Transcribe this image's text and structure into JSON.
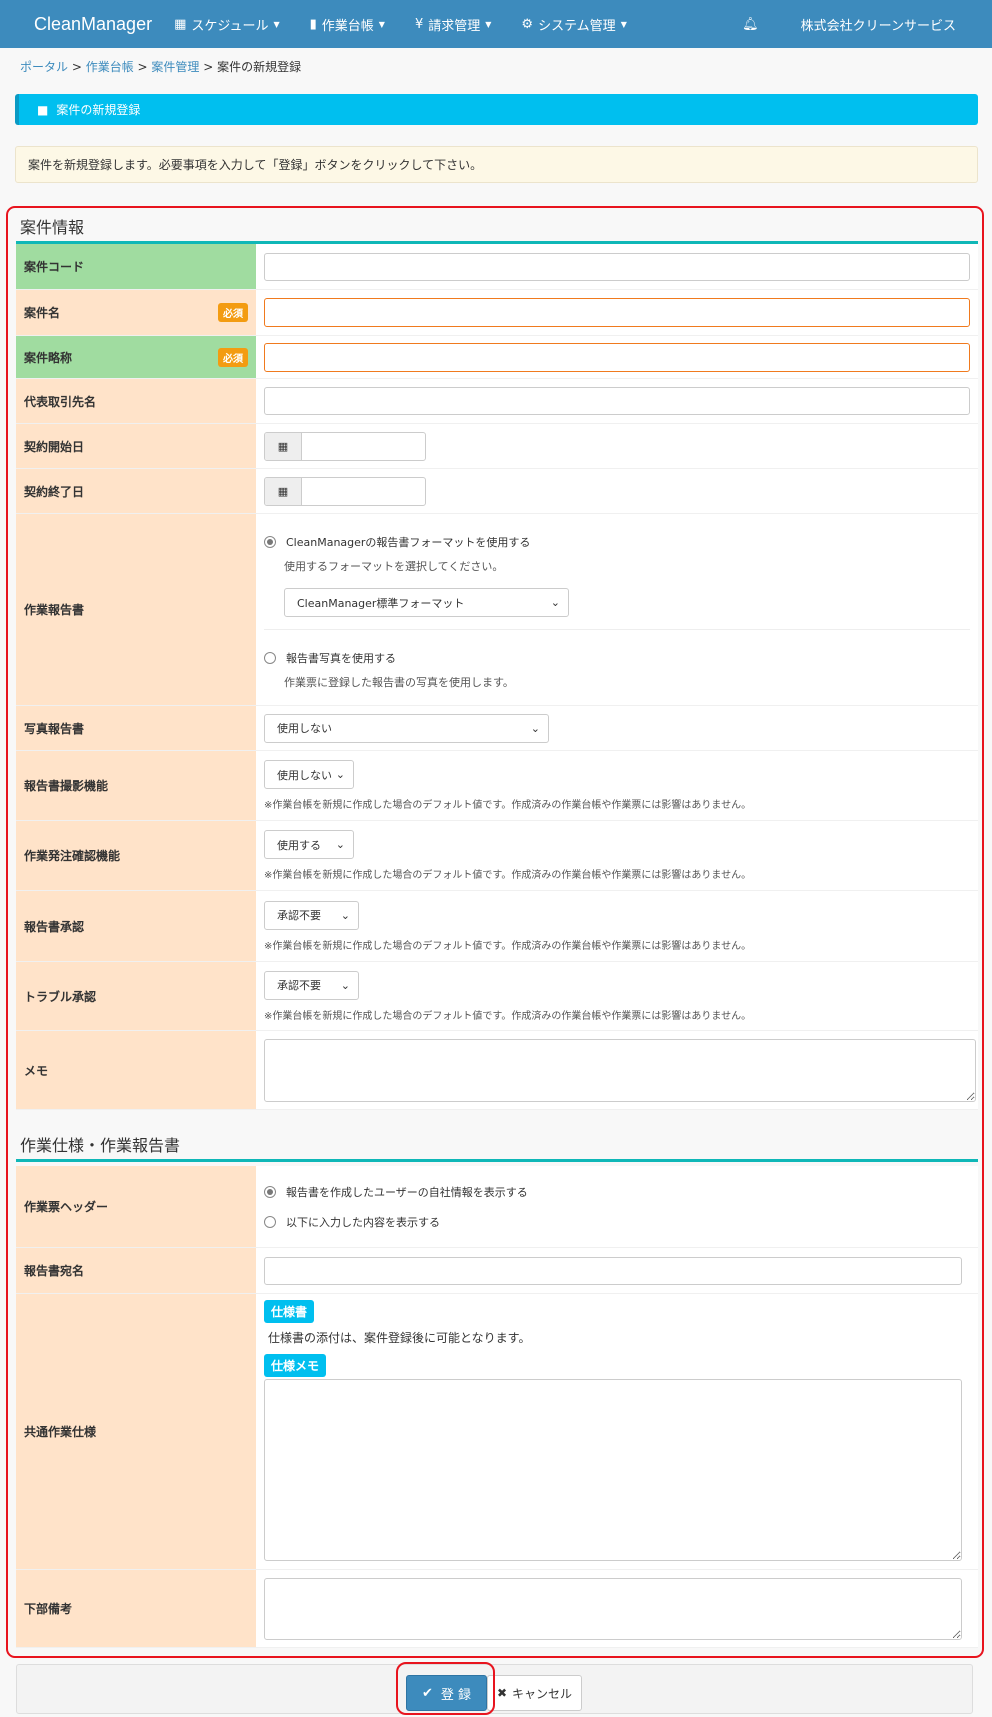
{
  "nav": {
    "brand": "CleanManager",
    "items": [
      {
        "icon": "calendar-icon",
        "label": "スケジュール"
      },
      {
        "icon": "book-icon",
        "label": "作業台帳"
      },
      {
        "icon": "yen-icon",
        "label": "請求管理"
      },
      {
        "icon": "gears-icon",
        "label": "システム管理"
      }
    ],
    "bell": "bell-icon",
    "company": "株式会社クリーンサービス"
  },
  "breadcrumb": [
    "ポータル",
    "作業台帳",
    "案件管理",
    "案件の新規登録"
  ],
  "title": "案件の新規登録",
  "alert": "案件を新規登録します。必要事項を入力して「登録」ボタンをクリックして下さい。",
  "required_label": "必須",
  "section1": {
    "heading": "案件情報",
    "fields": {
      "code": "案件コード",
      "name": "案件名",
      "short": "案件略称",
      "client": "代表取引先名",
      "start": "契約開始日",
      "end": "契約終了日",
      "report": "作業報告書",
      "photo_report": "写真報告書",
      "capture": "報告書撮影機能",
      "order_confirm": "作業発注確認機能",
      "report_approval": "報告書承認",
      "trouble_approval": "トラブル承認",
      "memo": "メモ"
    },
    "report_opt1": "CleanManagerの報告書フォーマットを使用する",
    "report_opt1_sub": "使用するフォーマットを選択してください。",
    "report_format": "CleanManager標準フォーマット",
    "report_opt2": "報告書写真を使用する",
    "report_opt2_sub": "作業票に登録した報告書の写真を使用します。",
    "photo_report_value": "使用しない",
    "capture_value": "使用しない",
    "order_confirm_value": "使用する",
    "report_approval_value": "承認不要",
    "trouble_approval_value": "承認不要",
    "default_note": "※作業台帳を新規に作成した場合のデフォルト値です。作成済みの作業台帳や作業票には影響はありません。"
  },
  "section2": {
    "heading": "作業仕様・作業報告書",
    "fields": {
      "header": "作業票ヘッダー",
      "addressee": "報告書宛名",
      "spec": "共通作業仕様",
      "footer_note": "下部備考"
    },
    "header_opt1": "報告書を作成したユーザーの自社情報を表示する",
    "header_opt2": "以下に入力した内容を表示する",
    "spec_badge": "仕様書",
    "spec_note": "仕様書の添付は、案件登録後に可能となります。",
    "spec_memo_badge": "仕様メモ"
  },
  "buttons": {
    "register": "登 録",
    "cancel": "キャンセル"
  }
}
